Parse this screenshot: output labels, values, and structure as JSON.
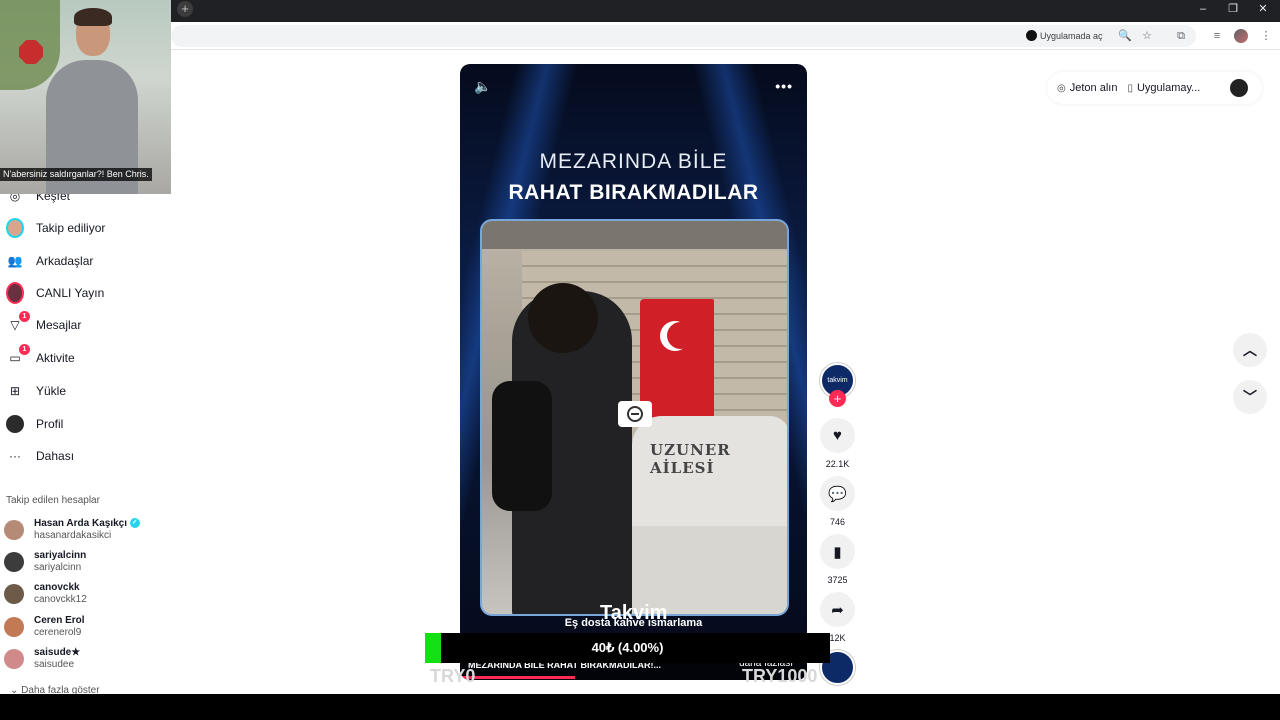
{
  "browser": {
    "open_in_app": "Uygulamada aç",
    "new_tab_symbol": "+",
    "window_controls": [
      "–",
      "❐",
      "✕"
    ]
  },
  "webcam": {
    "caption": "N'abersiniz saldırganlar?! Ben Chris."
  },
  "sidebar": {
    "items": [
      {
        "label": "Keşfet",
        "icon": "compass-icon"
      },
      {
        "label": "Takip ediliyor",
        "icon": "following-avatar-icon"
      },
      {
        "label": "Arkadaşlar",
        "icon": "friends-icon"
      },
      {
        "label": "CANLI Yayın",
        "icon": "live-icon"
      },
      {
        "label": "Mesajlar",
        "icon": "messages-icon",
        "badge": "1"
      },
      {
        "label": "Aktivite",
        "icon": "activity-icon",
        "badge": "1"
      },
      {
        "label": "Yükle",
        "icon": "upload-icon"
      },
      {
        "label": "Profil",
        "icon": "profile-avatar-icon"
      },
      {
        "label": "Dahası",
        "icon": "more-icon"
      }
    ],
    "following_title": "Takip edilen hesaplar",
    "following": [
      {
        "name": "Hasan Arda Kaşıkçı",
        "handle": "hasanardakasikci",
        "verified": true,
        "color": "#b58a76"
      },
      {
        "name": "sariyalcinn",
        "handle": "sariyalcinn",
        "verified": false,
        "color": "#3c3c3c"
      },
      {
        "name": "canovckk",
        "handle": "canovckk12",
        "verified": false,
        "color": "#6d5a48"
      },
      {
        "name": "Ceren Erol",
        "handle": "cerenerol9",
        "verified": false,
        "color": "#c27a55"
      },
      {
        "name": "saisude★",
        "handle": "saisudee",
        "verified": false,
        "color": "#d08a8a"
      }
    ],
    "show_more": "Daha fazla göster"
  },
  "topright": {
    "coins": "Jeton alın",
    "app": "Uygulamay..."
  },
  "video": {
    "headline_1": "MEZARINDA BİLE",
    "headline_2": "RAHAT BIRAKMADILAR",
    "tomb_text": "UZUNER AİLESİ",
    "brand": "Takvim",
    "subline": "Eş dosta kahve ısmarlama",
    "ticker": "MEZARINDA BİLE RAHAT BIRAKMADILAR!...",
    "ticker_right": "daha fazlası",
    "progress": 0.33
  },
  "donation": {
    "text": "40₺ (4.00%)",
    "percent": 4.0,
    "bar_color": "#15e015",
    "left_ghost": "TRY0",
    "right_ghost": "TRY1000"
  },
  "rail": {
    "avatar_label": "takvim",
    "likes": "22.1K",
    "comments": "746",
    "bookmarks": "3725",
    "shares": "12K"
  },
  "colors": {
    "accent": "#fe2c55",
    "verified": "#20d5ec"
  }
}
